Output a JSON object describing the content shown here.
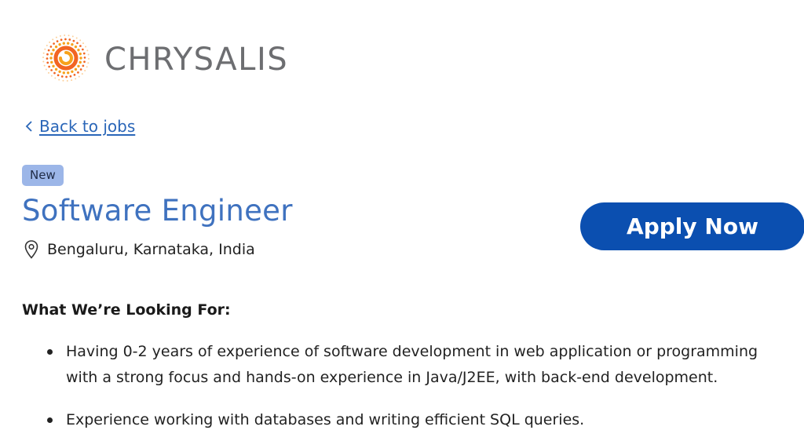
{
  "brand": {
    "name": "CHRYSALIS",
    "logo_icon": "swirl-logo-icon",
    "logo_colors": [
      "#f7a21b",
      "#f26522",
      "#fdd09a"
    ],
    "text_color": "#6d6e71"
  },
  "nav": {
    "back_label": "Back to jobs",
    "back_icon": "chevron-left-icon"
  },
  "job": {
    "badge": "New",
    "title": "Software Engineer",
    "location": "Bengaluru, Karnataka, India",
    "location_icon": "map-pin-icon"
  },
  "apply": {
    "label": "Apply Now",
    "color": "#0b4fb0"
  },
  "section": {
    "heading": "What We’re Looking For:",
    "bullets": [
      "Having 0-2 years of experience of software development in web application or programming with a strong focus and hands-on experience in Java/J2EE, with back-end development.",
      "Experience working with databases and writing efficient SQL queries."
    ]
  },
  "colors": {
    "link": "#2a66b8",
    "title": "#3f72bf",
    "badge_bg": "#9cb6e8"
  }
}
